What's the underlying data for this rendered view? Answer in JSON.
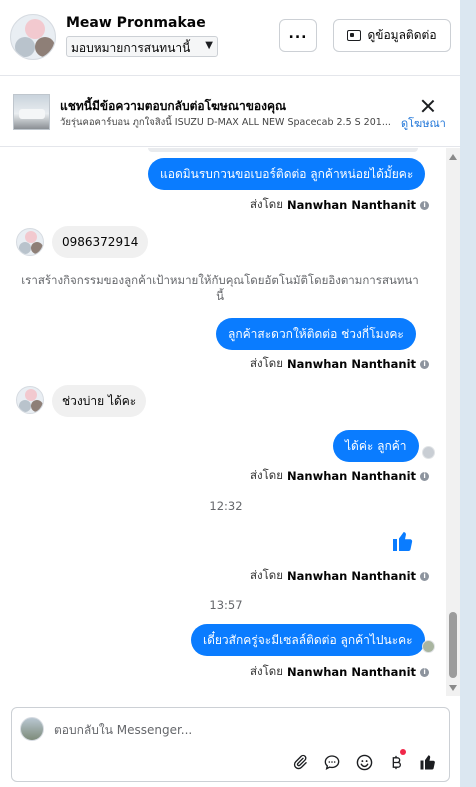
{
  "header": {
    "contact_name": "Meaw Pronmakae",
    "assign_select": "มอบหมายการสนทนานี้",
    "more_label": "...",
    "contact_info_label": "ดูข้อมูลติดต่อ"
  },
  "ad": {
    "title": "แชทนี้มีข้อความตอบกลับต่อโฆษณาของคุณ",
    "subtitle": "วัยรุ่นคอคาร์บอน ภูกใจสิงนี้ ISUZU D-MAX ALL NEW Spacecab 2.5 S 201...",
    "link": "ดูโฆษณา"
  },
  "messages": {
    "m1": "แอดมินรบกวนขอเบอร์ติดต่อ ลูกค้าหน่อยได้มั้ยคะ",
    "sent_prefix": "ส่งโดย",
    "agent_name": "Nanwhan Nanthanit",
    "m2": "0986372914",
    "system_note": "เราสร้างกิจกรรมของลูกค้าเป้าหมายให้กับคุณโดยอัตโนมัติโดยอิงตามการสนทนานี้",
    "m3": "ลูกค้าสะดวกให้ติดต่อ ช่วงกี่โมงคะ",
    "m4": "ช่วงบ่าย ได้คะ",
    "m5": "ได้ค่ะ  ลูกค้า",
    "time1": "12:32",
    "time2": "13:57",
    "m6": "เดี๋ยวสักครู่จะมีเซลล์ติดต่อ ลูกค้าไปนะคะ"
  },
  "composer": {
    "placeholder": "ตอบกลับใน Messenger..."
  },
  "colors": {
    "outgoing_bubble": "#0a7cff",
    "incoming_bubble": "#f0f0f0",
    "link": "#1d74d8",
    "notification": "#f02849"
  },
  "icons": [
    "ellipsis-icon",
    "contact-card-icon",
    "close-icon",
    "info-icon",
    "thumbs-up-icon",
    "attach-icon",
    "chat-bubble-icon",
    "emoji-icon",
    "currency-icon"
  ]
}
